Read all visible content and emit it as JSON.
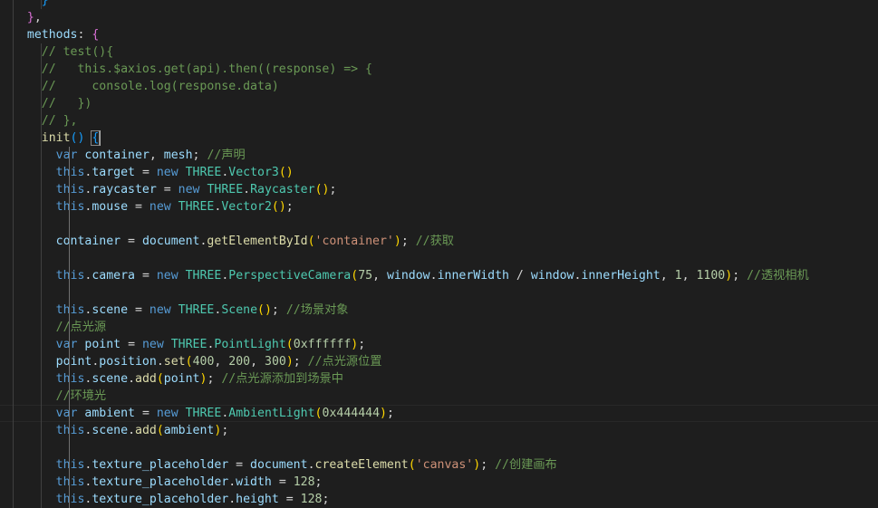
{
  "colors": {
    "background": "#1e1e1e",
    "text": "#d4d4d4",
    "keyword": "#569cd6",
    "this": "#569cd6",
    "variable": "#9cdcfe",
    "function": "#dcdcaa",
    "class": "#4ec9b0",
    "string": "#ce9178",
    "number": "#b5cea8",
    "comment": "#6a9955",
    "bracket": "#ffd700",
    "bracket2": "#da70d6",
    "bracket3": "#179fff"
  },
  "editor": {
    "lines": [
      {
        "guides": [
          1,
          2
        ],
        "tokens": [
          {
            "t": "    }",
            "c": "bracket3"
          }
        ]
      },
      {
        "guides": [
          1
        ],
        "tokens": [
          {
            "t": "  "
          },
          {
            "t": "}",
            "c": "bracket2"
          },
          {
            "t": ","
          }
        ]
      },
      {
        "guides": [
          1
        ],
        "tokens": [
          {
            "t": "  "
          },
          {
            "t": "methods",
            "c": "variable"
          },
          {
            "t": ": "
          },
          {
            "t": "{",
            "c": "bracket2"
          }
        ]
      },
      {
        "guides": [
          1,
          2
        ],
        "tokens": [
          {
            "t": "    "
          },
          {
            "t": "// test(){",
            "c": "comment"
          }
        ]
      },
      {
        "guides": [
          1,
          2
        ],
        "tokens": [
          {
            "t": "    "
          },
          {
            "t": "//   this.$axios.get(api).then((response) => {",
            "c": "comment"
          }
        ]
      },
      {
        "guides": [
          1,
          2
        ],
        "tokens": [
          {
            "t": "    "
          },
          {
            "t": "//     console.log(response.data)",
            "c": "comment"
          }
        ]
      },
      {
        "guides": [
          1,
          2
        ],
        "tokens": [
          {
            "t": "    "
          },
          {
            "t": "//   })",
            "c": "comment"
          }
        ]
      },
      {
        "guides": [
          1,
          2
        ],
        "tokens": [
          {
            "t": "    "
          },
          {
            "t": "// },",
            "c": "comment"
          }
        ]
      },
      {
        "guides": [
          1,
          2
        ],
        "tokens": [
          {
            "t": "    "
          },
          {
            "t": "init",
            "c": "function"
          },
          {
            "t": "()",
            "c": "bracket3"
          },
          {
            "t": " "
          },
          {
            "t": "{",
            "c": "bracket3",
            "match": true
          }
        ]
      },
      {
        "guides": [
          1,
          2,
          3
        ],
        "tokens": [
          {
            "t": "      "
          },
          {
            "t": "var",
            "c": "keyword"
          },
          {
            "t": " "
          },
          {
            "t": "container",
            "c": "variable"
          },
          {
            "t": ", "
          },
          {
            "t": "mesh",
            "c": "variable"
          },
          {
            "t": "; "
          },
          {
            "t": "//声明",
            "c": "comment"
          }
        ]
      },
      {
        "guides": [
          1,
          2,
          3
        ],
        "tokens": [
          {
            "t": "      "
          },
          {
            "t": "this",
            "c": "this"
          },
          {
            "t": "."
          },
          {
            "t": "target",
            "c": "variable"
          },
          {
            "t": " = "
          },
          {
            "t": "new",
            "c": "keyword"
          },
          {
            "t": " "
          },
          {
            "t": "THREE",
            "c": "class"
          },
          {
            "t": "."
          },
          {
            "t": "Vector3",
            "c": "class"
          },
          {
            "t": "()",
            "c": "bracket"
          }
        ]
      },
      {
        "guides": [
          1,
          2,
          3
        ],
        "tokens": [
          {
            "t": "      "
          },
          {
            "t": "this",
            "c": "this"
          },
          {
            "t": "."
          },
          {
            "t": "raycaster",
            "c": "variable"
          },
          {
            "t": " = "
          },
          {
            "t": "new",
            "c": "keyword"
          },
          {
            "t": " "
          },
          {
            "t": "THREE",
            "c": "class"
          },
          {
            "t": "."
          },
          {
            "t": "Raycaster",
            "c": "class"
          },
          {
            "t": "()",
            "c": "bracket"
          },
          {
            "t": ";"
          }
        ]
      },
      {
        "guides": [
          1,
          2,
          3
        ],
        "tokens": [
          {
            "t": "      "
          },
          {
            "t": "this",
            "c": "this"
          },
          {
            "t": "."
          },
          {
            "t": "mouse",
            "c": "variable"
          },
          {
            "t": " = "
          },
          {
            "t": "new",
            "c": "keyword"
          },
          {
            "t": " "
          },
          {
            "t": "THREE",
            "c": "class"
          },
          {
            "t": "."
          },
          {
            "t": "Vector2",
            "c": "class"
          },
          {
            "t": "()",
            "c": "bracket"
          },
          {
            "t": ";"
          }
        ]
      },
      {
        "guides": [
          1,
          2,
          3
        ],
        "tokens": []
      },
      {
        "guides": [
          1,
          2,
          3
        ],
        "tokens": [
          {
            "t": "      "
          },
          {
            "t": "container",
            "c": "variable"
          },
          {
            "t": " = "
          },
          {
            "t": "document",
            "c": "variable"
          },
          {
            "t": "."
          },
          {
            "t": "getElementById",
            "c": "function"
          },
          {
            "t": "(",
            "c": "bracket"
          },
          {
            "t": "'container'",
            "c": "string"
          },
          {
            "t": ")",
            "c": "bracket"
          },
          {
            "t": "; "
          },
          {
            "t": "//获取",
            "c": "comment"
          }
        ]
      },
      {
        "guides": [
          1,
          2,
          3
        ],
        "tokens": []
      },
      {
        "guides": [
          1,
          2,
          3
        ],
        "tokens": [
          {
            "t": "      "
          },
          {
            "t": "this",
            "c": "this"
          },
          {
            "t": "."
          },
          {
            "t": "camera",
            "c": "variable"
          },
          {
            "t": " = "
          },
          {
            "t": "new",
            "c": "keyword"
          },
          {
            "t": " "
          },
          {
            "t": "THREE",
            "c": "class"
          },
          {
            "t": "."
          },
          {
            "t": "PerspectiveCamera",
            "c": "class"
          },
          {
            "t": "(",
            "c": "bracket"
          },
          {
            "t": "75",
            "c": "number"
          },
          {
            "t": ", "
          },
          {
            "t": "window",
            "c": "variable"
          },
          {
            "t": "."
          },
          {
            "t": "innerWidth",
            "c": "variable"
          },
          {
            "t": " / "
          },
          {
            "t": "window",
            "c": "variable"
          },
          {
            "t": "."
          },
          {
            "t": "innerHeight",
            "c": "variable"
          },
          {
            "t": ", "
          },
          {
            "t": "1",
            "c": "number"
          },
          {
            "t": ", "
          },
          {
            "t": "1100",
            "c": "number"
          },
          {
            "t": ")",
            "c": "bracket"
          },
          {
            "t": "; "
          },
          {
            "t": "//透视相机",
            "c": "comment"
          }
        ]
      },
      {
        "guides": [
          1,
          2,
          3
        ],
        "tokens": []
      },
      {
        "guides": [
          1,
          2,
          3
        ],
        "tokens": [
          {
            "t": "      "
          },
          {
            "t": "this",
            "c": "this"
          },
          {
            "t": "."
          },
          {
            "t": "scene",
            "c": "variable"
          },
          {
            "t": " = "
          },
          {
            "t": "new",
            "c": "keyword"
          },
          {
            "t": " "
          },
          {
            "t": "THREE",
            "c": "class"
          },
          {
            "t": "."
          },
          {
            "t": "Scene",
            "c": "class"
          },
          {
            "t": "()",
            "c": "bracket"
          },
          {
            "t": "; "
          },
          {
            "t": "//场景对象",
            "c": "comment"
          }
        ]
      },
      {
        "guides": [
          1,
          2,
          3
        ],
        "tokens": [
          {
            "t": "      "
          },
          {
            "t": "//点光源",
            "c": "comment"
          }
        ]
      },
      {
        "guides": [
          1,
          2,
          3
        ],
        "tokens": [
          {
            "t": "      "
          },
          {
            "t": "var",
            "c": "keyword"
          },
          {
            "t": " "
          },
          {
            "t": "point",
            "c": "variable"
          },
          {
            "t": " = "
          },
          {
            "t": "new",
            "c": "keyword"
          },
          {
            "t": " "
          },
          {
            "t": "THREE",
            "c": "class"
          },
          {
            "t": "."
          },
          {
            "t": "PointLight",
            "c": "class"
          },
          {
            "t": "(",
            "c": "bracket"
          },
          {
            "t": "0xffffff",
            "c": "number"
          },
          {
            "t": ")",
            "c": "bracket"
          },
          {
            "t": ";"
          }
        ]
      },
      {
        "guides": [
          1,
          2,
          3
        ],
        "tokens": [
          {
            "t": "      "
          },
          {
            "t": "point",
            "c": "variable"
          },
          {
            "t": "."
          },
          {
            "t": "position",
            "c": "variable"
          },
          {
            "t": "."
          },
          {
            "t": "set",
            "c": "function"
          },
          {
            "t": "(",
            "c": "bracket"
          },
          {
            "t": "400",
            "c": "number"
          },
          {
            "t": ", "
          },
          {
            "t": "200",
            "c": "number"
          },
          {
            "t": ", "
          },
          {
            "t": "300",
            "c": "number"
          },
          {
            "t": ")",
            "c": "bracket"
          },
          {
            "t": "; "
          },
          {
            "t": "//点光源位置",
            "c": "comment"
          }
        ]
      },
      {
        "guides": [
          1,
          2,
          3
        ],
        "tokens": [
          {
            "t": "      "
          },
          {
            "t": "this",
            "c": "this"
          },
          {
            "t": "."
          },
          {
            "t": "scene",
            "c": "variable"
          },
          {
            "t": "."
          },
          {
            "t": "add",
            "c": "function"
          },
          {
            "t": "(",
            "c": "bracket"
          },
          {
            "t": "point",
            "c": "variable"
          },
          {
            "t": ")",
            "c": "bracket"
          },
          {
            "t": "; "
          },
          {
            "t": "//点光源添加到场景中",
            "c": "comment"
          }
        ]
      },
      {
        "guides": [
          1,
          2,
          3
        ],
        "tokens": [
          {
            "t": "      "
          },
          {
            "t": "//环境光",
            "c": "comment"
          }
        ]
      },
      {
        "guides": [
          1,
          2,
          3
        ],
        "current": true,
        "tokens": [
          {
            "t": "      "
          },
          {
            "t": "var",
            "c": "keyword"
          },
          {
            "t": " "
          },
          {
            "t": "ambient",
            "c": "variable"
          },
          {
            "t": " = "
          },
          {
            "t": "new",
            "c": "keyword"
          },
          {
            "t": " "
          },
          {
            "t": "THREE",
            "c": "class"
          },
          {
            "t": "."
          },
          {
            "t": "AmbientLight",
            "c": "class"
          },
          {
            "t": "(",
            "c": "bracket"
          },
          {
            "t": "0x444444",
            "c": "number"
          },
          {
            "t": ")",
            "c": "bracket"
          },
          {
            "t": ";"
          }
        ]
      },
      {
        "guides": [
          1,
          2,
          3
        ],
        "tokens": [
          {
            "t": "      "
          },
          {
            "t": "this",
            "c": "this"
          },
          {
            "t": "."
          },
          {
            "t": "scene",
            "c": "variable"
          },
          {
            "t": "."
          },
          {
            "t": "add",
            "c": "function"
          },
          {
            "t": "(",
            "c": "bracket"
          },
          {
            "t": "ambient",
            "c": "variable"
          },
          {
            "t": ")",
            "c": "bracket"
          },
          {
            "t": ";"
          }
        ]
      },
      {
        "guides": [
          1,
          2,
          3
        ],
        "tokens": []
      },
      {
        "guides": [
          1,
          2,
          3
        ],
        "tokens": [
          {
            "t": "      "
          },
          {
            "t": "this",
            "c": "this"
          },
          {
            "t": "."
          },
          {
            "t": "texture_placeholder",
            "c": "variable"
          },
          {
            "t": " = "
          },
          {
            "t": "document",
            "c": "variable"
          },
          {
            "t": "."
          },
          {
            "t": "createElement",
            "c": "function"
          },
          {
            "t": "(",
            "c": "bracket"
          },
          {
            "t": "'canvas'",
            "c": "string"
          },
          {
            "t": ")",
            "c": "bracket"
          },
          {
            "t": "; "
          },
          {
            "t": "//创建画布",
            "c": "comment"
          }
        ]
      },
      {
        "guides": [
          1,
          2,
          3
        ],
        "tokens": [
          {
            "t": "      "
          },
          {
            "t": "this",
            "c": "this"
          },
          {
            "t": "."
          },
          {
            "t": "texture_placeholder",
            "c": "variable"
          },
          {
            "t": "."
          },
          {
            "t": "width",
            "c": "variable"
          },
          {
            "t": " = "
          },
          {
            "t": "128",
            "c": "number"
          },
          {
            "t": ";"
          }
        ]
      },
      {
        "guides": [
          1,
          2,
          3
        ],
        "tokens": [
          {
            "t": "      "
          },
          {
            "t": "this",
            "c": "this"
          },
          {
            "t": "."
          },
          {
            "t": "texture_placeholder",
            "c": "variable"
          },
          {
            "t": "."
          },
          {
            "t": "height",
            "c": "variable"
          },
          {
            "t": " = "
          },
          {
            "t": "128",
            "c": "number"
          },
          {
            "t": ";"
          }
        ]
      }
    ]
  }
}
